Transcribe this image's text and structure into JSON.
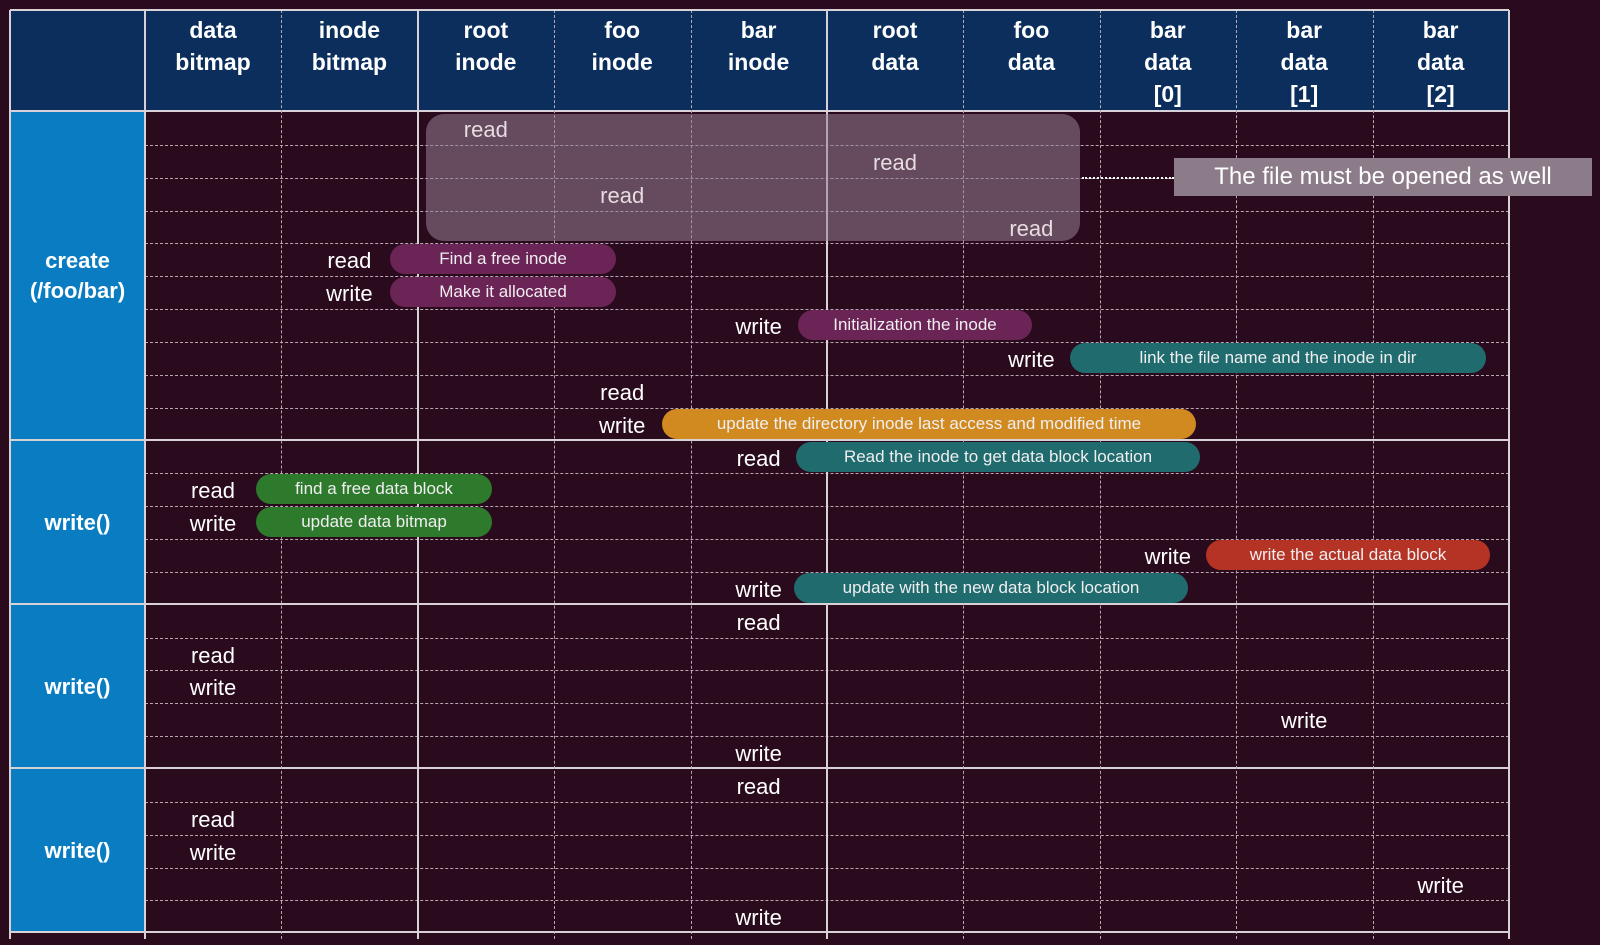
{
  "columns": [
    "data\nbitmap",
    "inode\nbitmap",
    "root\ninode",
    "foo\ninode",
    "bar\ninode",
    "root\ndata",
    "foo\ndata",
    "bar\ndata\n[0]",
    "bar\ndata\n[1]",
    "bar\ndata\n[2]"
  ],
  "groups": [
    {
      "label": "create\n(/foo/bar)"
    },
    {
      "label": "write()"
    },
    {
      "label": "write()"
    },
    {
      "label": "write()"
    }
  ],
  "ops": [
    {
      "col": 2,
      "row": 0,
      "text": "read",
      "faint": true
    },
    {
      "col": 5,
      "row": 1,
      "text": "read",
      "faint": true
    },
    {
      "col": 3,
      "row": 2,
      "text": "read",
      "faint": true
    },
    {
      "col": 6,
      "row": 3,
      "text": "read",
      "faint": true
    },
    {
      "col": 1,
      "row": 4,
      "text": "read"
    },
    {
      "col": 1,
      "row": 5,
      "text": "write"
    },
    {
      "col": 4,
      "row": 6,
      "text": "write"
    },
    {
      "col": 6,
      "row": 7,
      "text": "write"
    },
    {
      "col": 3,
      "row": 8,
      "text": "read"
    },
    {
      "col": 3,
      "row": 9,
      "text": "write"
    },
    {
      "col": 4,
      "row": 10,
      "text": "read"
    },
    {
      "col": 0,
      "row": 11,
      "text": "read"
    },
    {
      "col": 0,
      "row": 12,
      "text": "write"
    },
    {
      "col": 7,
      "row": 13,
      "text": "write"
    },
    {
      "col": 4,
      "row": 14,
      "text": "write"
    },
    {
      "col": 4,
      "row": 15,
      "text": "read"
    },
    {
      "col": 0,
      "row": 16,
      "text": "read"
    },
    {
      "col": 0,
      "row": 17,
      "text": "write"
    },
    {
      "col": 8,
      "row": 18,
      "text": "write"
    },
    {
      "col": 4,
      "row": 19,
      "text": "write"
    },
    {
      "col": 4,
      "row": 20,
      "text": "read"
    },
    {
      "col": 0,
      "row": 21,
      "text": "read"
    },
    {
      "col": 0,
      "row": 22,
      "text": "write"
    },
    {
      "col": 9,
      "row": 23,
      "text": "write"
    },
    {
      "col": 4,
      "row": 24,
      "text": "write"
    }
  ],
  "annotations": [
    {
      "row": 4,
      "text": "Find a free inode",
      "color": "#6b2456"
    },
    {
      "row": 5,
      "text": "Make it allocated",
      "color": "#6b2456"
    },
    {
      "row": 6,
      "text": "Initialization the inode",
      "color": "#6b2456"
    },
    {
      "row": 7,
      "text": "link the file name and the inode in dir",
      "color": "#1f6b6e"
    },
    {
      "row": 9,
      "text": "update the directory inode last access and modified time",
      "color": "#d08a1f"
    },
    {
      "row": 10,
      "text": "Read the inode to get data block location",
      "color": "#1f6b6e"
    },
    {
      "row": 11,
      "text": "find a free data block",
      "color": "#2d7a2d"
    },
    {
      "row": 12,
      "text": "update data bitmap",
      "color": "#2d7a2d"
    },
    {
      "row": 13,
      "text": "write the actual data block",
      "color": "#b53324"
    },
    {
      "row": 14,
      "text": "update with the new data block location",
      "color": "#1f6b6e"
    }
  ],
  "callout": {
    "text": "The file must be opened as well"
  }
}
